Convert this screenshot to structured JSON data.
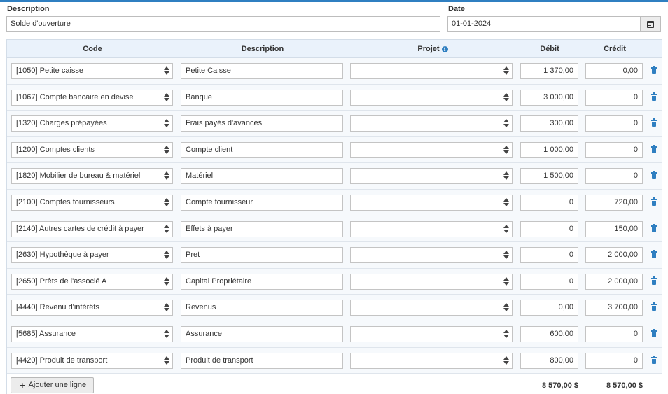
{
  "form": {
    "description_label": "Description",
    "description_value": "Solde d'ouverture",
    "date_label": "Date",
    "date_value": "01-01-2024"
  },
  "table": {
    "headers": {
      "code": "Code",
      "description": "Description",
      "projet": "Projet",
      "debit": "Débit",
      "credit": "Crédit"
    },
    "rows": [
      {
        "code": "[1050] Petite caisse",
        "description": "Petite Caisse",
        "projet": "",
        "debit": "1 370,00",
        "credit": "0,00"
      },
      {
        "code": "[1067] Compte bancaire en devise",
        "description": "Banque",
        "projet": "",
        "debit": "3 000,00",
        "credit": "0"
      },
      {
        "code": "[1320] Charges prépayées",
        "description": "Frais payés d'avances",
        "projet": "",
        "debit": "300,00",
        "credit": "0"
      },
      {
        "code": "[1200] Comptes clients",
        "description": "Compte client",
        "projet": "",
        "debit": "1 000,00",
        "credit": "0"
      },
      {
        "code": "[1820] Mobilier de bureau & matériel",
        "description": "Matériel",
        "projet": "",
        "debit": "1 500,00",
        "credit": "0"
      },
      {
        "code": "[2100] Comptes fournisseurs",
        "description": "Compte fournisseur",
        "projet": "",
        "debit": "0",
        "credit": "720,00"
      },
      {
        "code": "[2140] Autres cartes de crédit à payer",
        "description": "Effets à payer",
        "projet": "",
        "debit": "0",
        "credit": "150,00"
      },
      {
        "code": "[2630] Hypothèque à payer",
        "description": "Pret",
        "projet": "",
        "debit": "0",
        "credit": "2 000,00"
      },
      {
        "code": "[2650] Prêts de l'associé A",
        "description": "Capital Propriétaire",
        "projet": "",
        "debit": "0",
        "credit": "2 000,00"
      },
      {
        "code": "[4440] Revenu d'intérêts",
        "description": "Revenus",
        "projet": "",
        "debit": "0,00",
        "credit": "3 700,00"
      },
      {
        "code": "[5685] Assurance",
        "description": "Assurance",
        "projet": "",
        "debit": "600,00",
        "credit": "0"
      },
      {
        "code": "[4420] Produit de transport",
        "description": "Produit de transport",
        "projet": "",
        "debit": "800,00",
        "credit": "0"
      }
    ],
    "add_line_label": "Ajouter une ligne",
    "total_debit": "8 570,00 $",
    "total_credit": "8 570,00 $"
  },
  "colors": {
    "accent": "#2f7fc1",
    "header_bg": "#eaf2fb",
    "row_bg": "#f6f9fc"
  },
  "icons": [
    "calendar-icon",
    "info-icon",
    "spinner-icon",
    "trash-icon",
    "plus-icon"
  ]
}
